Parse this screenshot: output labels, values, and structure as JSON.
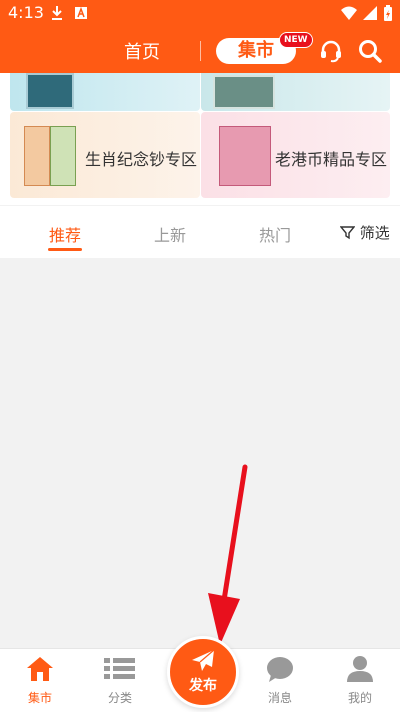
{
  "status": {
    "time": "4:13"
  },
  "header": {
    "home_label": "首页",
    "market_label": "集市",
    "new_badge": "NEW"
  },
  "cards": [
    {
      "label": "生肖纪念钞专区"
    },
    {
      "label": "老港币精品专区"
    }
  ],
  "tabs": [
    {
      "label": "推荐",
      "active": true
    },
    {
      "label": "上新",
      "active": false
    },
    {
      "label": "热门",
      "active": false
    }
  ],
  "filter": {
    "label": "筛选"
  },
  "bottom_nav": {
    "items": [
      {
        "label": "集市",
        "active": true
      },
      {
        "label": "分类",
        "active": false
      },
      {
        "label": "消息",
        "active": false
      },
      {
        "label": "我的",
        "active": false
      }
    ],
    "publish_label": "发布"
  },
  "colors": {
    "accent": "#ff5a14",
    "arrow": "#e8101d"
  }
}
